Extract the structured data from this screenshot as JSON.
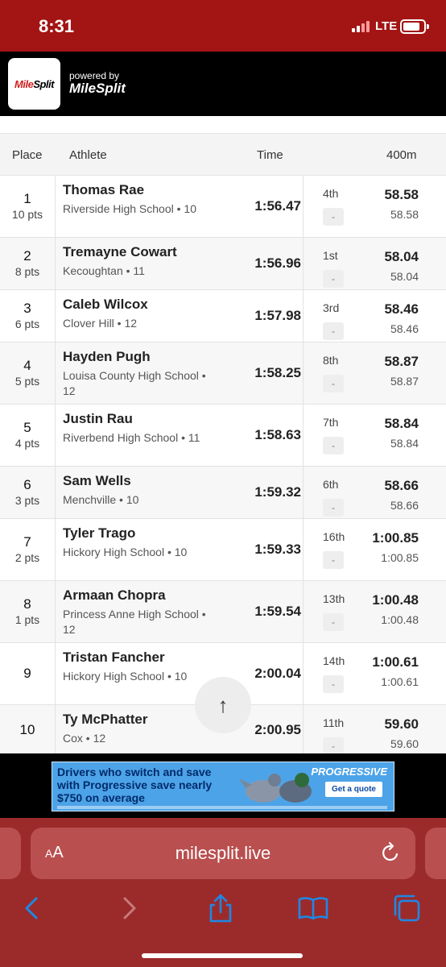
{
  "status_bar": {
    "time": "8:31",
    "network": "LTE"
  },
  "header": {
    "logo_text_red": "Mile",
    "logo_text_black": "Split",
    "powered_by": "powered by",
    "brand": "MileSplit"
  },
  "table": {
    "headers": {
      "place": "Place",
      "athlete": "Athlete",
      "time": "Time",
      "split": "400m"
    },
    "rows": [
      {
        "place": "1",
        "pts": "10 pts",
        "name": "Thomas Rae",
        "school": "Riverside High School • 10",
        "time": "1:56.47",
        "split_place": "4th",
        "split_dash": "-",
        "split_main": "58.58",
        "split_sub": "58.58"
      },
      {
        "place": "2",
        "pts": "8 pts",
        "name": "Tremayne Cowart",
        "school": "Kecoughtan • 11",
        "time": "1:56.96",
        "split_place": "1st",
        "split_dash": "-",
        "split_main": "58.04",
        "split_sub": "58.04"
      },
      {
        "place": "3",
        "pts": "6 pts",
        "name": "Caleb Wilcox",
        "school": "Clover Hill • 12",
        "time": "1:57.98",
        "split_place": "3rd",
        "split_dash": "-",
        "split_main": "58.46",
        "split_sub": "58.46"
      },
      {
        "place": "4",
        "pts": "5 pts",
        "name": "Hayden Pugh",
        "school": "Louisa County High School • 12",
        "time": "1:58.25",
        "split_place": "8th",
        "split_dash": "-",
        "split_main": "58.87",
        "split_sub": "58.87"
      },
      {
        "place": "5",
        "pts": "4 pts",
        "name": "Justin Rau",
        "school": "Riverbend High School • 11",
        "time": "1:58.63",
        "split_place": "7th",
        "split_dash": "-",
        "split_main": "58.84",
        "split_sub": "58.84"
      },
      {
        "place": "6",
        "pts": "3 pts",
        "name": "Sam Wells",
        "school": "Menchville • 10",
        "time": "1:59.32",
        "split_place": "6th",
        "split_dash": "-",
        "split_main": "58.66",
        "split_sub": "58.66"
      },
      {
        "place": "7",
        "pts": "2 pts",
        "name": "Tyler Trago",
        "school": "Hickory High School • 10",
        "time": "1:59.33",
        "split_place": "16th",
        "split_dash": "-",
        "split_main": "1:00.85",
        "split_sub": "1:00.85"
      },
      {
        "place": "8",
        "pts": "1 pts",
        "name": "Armaan Chopra",
        "school": "Princess Anne High School • 12",
        "time": "1:59.54",
        "split_place": "13th",
        "split_dash": "-",
        "split_main": "1:00.48",
        "split_sub": "1:00.48"
      },
      {
        "place": "9",
        "pts": "",
        "name": "Tristan Fancher",
        "school": "Hickory High School • 10",
        "time": "2:00.04",
        "split_place": "14th",
        "split_dash": "-",
        "split_main": "1:00.61",
        "split_sub": "1:00.61"
      },
      {
        "place": "10",
        "pts": "",
        "name": "Ty McPhatter",
        "school": "Cox • 12",
        "time": "2:00.95",
        "split_place": "11th",
        "split_dash": "-",
        "split_main": "59.60",
        "split_sub": "59.60"
      }
    ]
  },
  "scroll_top": {
    "icon": "↑"
  },
  "ad": {
    "headline": "Drivers who switch and save with Progressive save nearly $750 on average",
    "brand": "PROGRESSIVE",
    "cta": "Get a quote"
  },
  "browser": {
    "aa_small": "A",
    "aa_large": "A",
    "url": "milesplit.live"
  },
  "colors": {
    "status_bar": "#a31414",
    "browser_chrome": "#9b2b2b",
    "url_bar": "#b94f4f",
    "ad_blue": "#4da3e8",
    "icon_blue": "#1e88e5"
  }
}
